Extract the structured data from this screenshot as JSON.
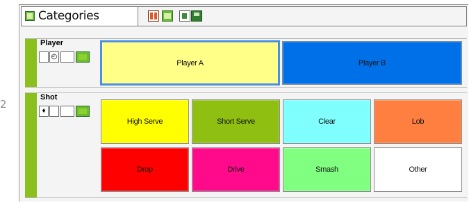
{
  "page_number": "2",
  "window": {
    "title": "Categories",
    "toolbar_icons": [
      "layout-columns-icon",
      "layout-rows-icon",
      "document-icon",
      "save-icon"
    ]
  },
  "groups": {
    "player": {
      "name": "Player",
      "controls": [
        "checkbox",
        "timer-icon",
        "blank-toggle",
        "color-toggle"
      ],
      "buttons": [
        {
          "label": "Player A",
          "color": "#ffff88",
          "selected": true
        },
        {
          "label": "Player B",
          "color": "#0070e8",
          "selected": false
        }
      ]
    },
    "shot": {
      "name": "Shot",
      "controls": [
        "diamond-icon",
        "checkbox",
        "blank-toggle",
        "color-toggle"
      ],
      "buttons": [
        {
          "label": "High Serve",
          "color": "#ffff00"
        },
        {
          "label": "Short Serve",
          "color": "#8fbf10"
        },
        {
          "label": "Clear",
          "color": "#80ffff"
        },
        {
          "label": "Lob",
          "color": "#ff7f40"
        },
        {
          "label": "Drop",
          "color": "#ff0000"
        },
        {
          "label": "Drive",
          "color": "#ff0a8a"
        },
        {
          "label": "Smash",
          "color": "#80ff80"
        },
        {
          "label": "Other",
          "color": "#ffffff"
        }
      ]
    }
  },
  "colors": {
    "stripe": "#8bbf1e",
    "selected_border": "#4a90e2"
  }
}
